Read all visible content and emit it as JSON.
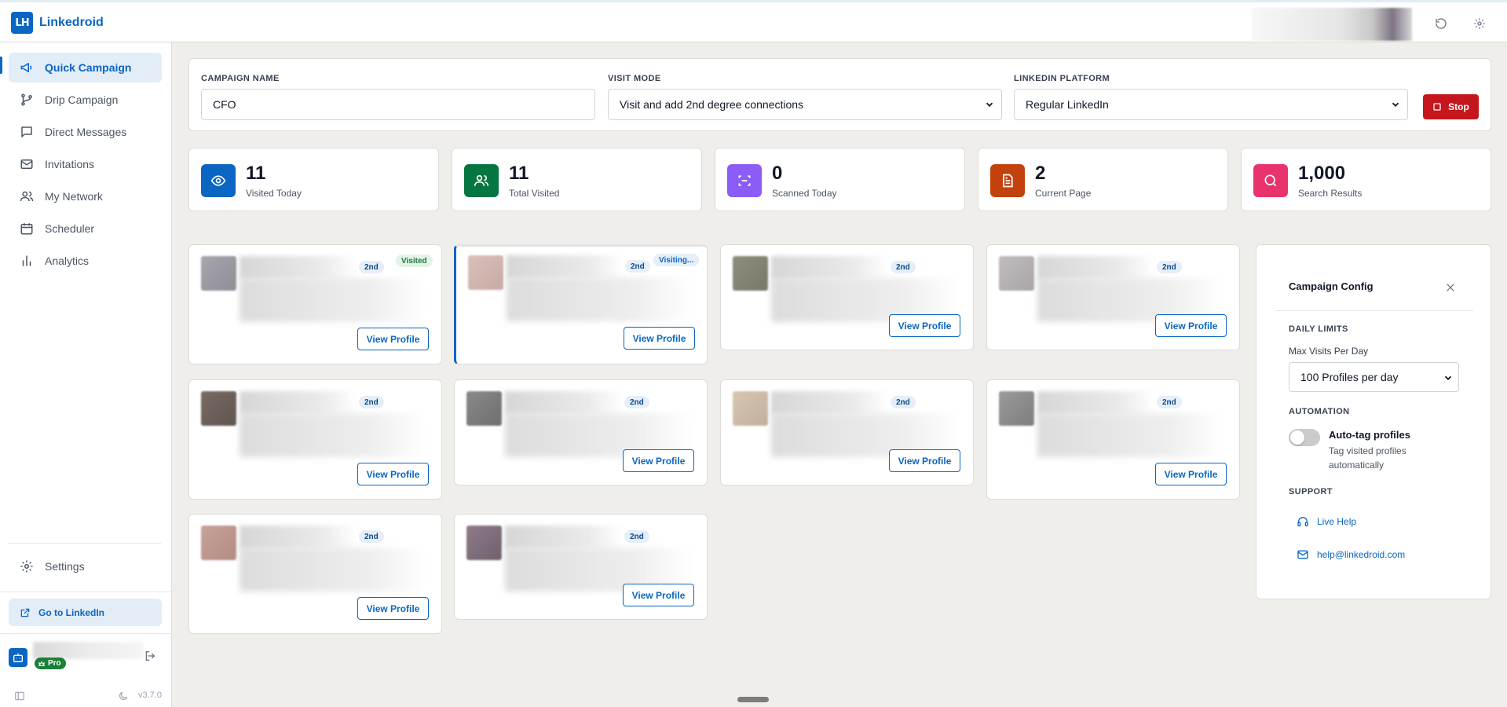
{
  "app": {
    "name": "Linkedroid",
    "logo_text": "LH",
    "version": "v3.7.0"
  },
  "sidebar": {
    "items": [
      {
        "label": "Quick Campaign",
        "icon": "megaphone-icon",
        "active": true
      },
      {
        "label": "Drip Campaign",
        "icon": "git-branch-icon"
      },
      {
        "label": "Direct Messages",
        "icon": "message-square-icon"
      },
      {
        "label": "Invitations",
        "icon": "mail-icon"
      },
      {
        "label": "My Network",
        "icon": "users-icon"
      },
      {
        "label": "Scheduler",
        "icon": "calendar-icon"
      },
      {
        "label": "Analytics",
        "icon": "bar-chart-icon"
      }
    ],
    "settings_label": "Settings",
    "goto_label": "Go to LinkedIn",
    "pro_label": "Pro"
  },
  "form": {
    "campaign_name_label": "CAMPAIGN NAME",
    "campaign_name_value": "CFO",
    "visit_mode_label": "VISIT MODE",
    "visit_mode_value": "Visit and add 2nd degree connections",
    "platform_label": "LINKEDIN PLATFORM",
    "platform_value": "Regular LinkedIn",
    "stop_label": "Stop"
  },
  "stats": [
    {
      "value": "11",
      "label": "Visited Today",
      "color": "#0a66c2",
      "icon": "eye-icon"
    },
    {
      "value": "11",
      "label": "Total Visited",
      "color": "#057642",
      "icon": "users-icon"
    },
    {
      "value": "0",
      "label": "Scanned Today",
      "color": "#8b5cf6",
      "icon": "scan-icon"
    },
    {
      "value": "2",
      "label": "Current Page",
      "color": "#c2410c",
      "icon": "file-text-icon"
    },
    {
      "value": "1,000",
      "label": "Search Results",
      "color": "#e8336d",
      "icon": "search-icon"
    }
  ],
  "profiles": {
    "degree_label": "2nd",
    "view_label": "View Profile",
    "visited_label": "Visited",
    "visiting_label": "Visiting..."
  },
  "config": {
    "title": "Campaign Config",
    "daily_limits_label": "DAILY LIMITS",
    "max_visits_label": "Max Visits Per Day",
    "max_visits_value": "100 Profiles per day",
    "automation_label": "AUTOMATION",
    "autotag_title": "Auto-tag profiles",
    "autotag_desc": "Tag visited profiles automatically",
    "support_label": "SUPPORT",
    "live_help_label": "Live Help",
    "email_label": "help@linkedroid.com"
  }
}
